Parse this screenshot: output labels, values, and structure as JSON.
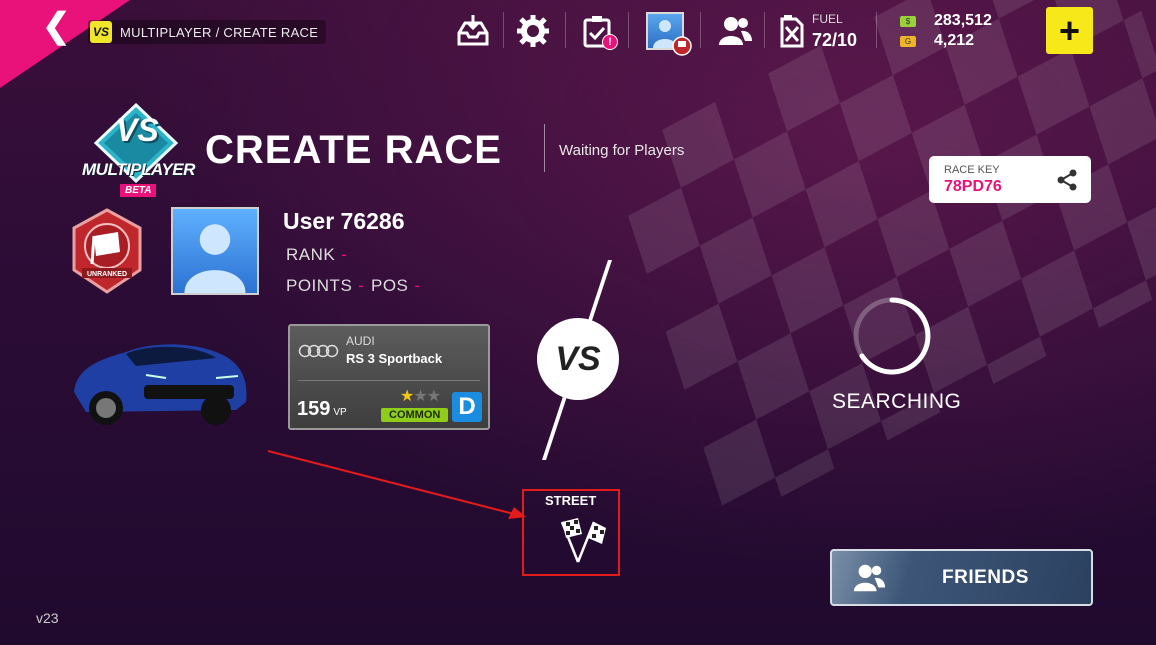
{
  "breadcrumb": {
    "logo": "VS",
    "text": "MULTIPLAYER / CREATE RACE"
  },
  "topbar": {
    "icons": [
      "inbox-icon",
      "gear-icon",
      "task-clipboard-icon",
      "profile-avatar-icon",
      "friends-icon",
      "fuel-can-icon"
    ],
    "task_badge": "!",
    "fuel_label": "FUEL",
    "fuel_value": "72/10",
    "credits": "283,512",
    "credits_chip": "$",
    "tokens": "4,212",
    "tokens_chip": "G",
    "plus_label": "+"
  },
  "header": {
    "logo_text": "VS",
    "multiplayer": "MULTIPLAYER",
    "beta": "BETA",
    "title": "CREATE RACE",
    "subtitle": "Waiting for Players"
  },
  "race_key": {
    "label": "RACE KEY",
    "value": "78PD76"
  },
  "player": {
    "rank_badge": "UNRANKED",
    "name": "User 76286",
    "rank_label": "RANK",
    "rank_value": "-",
    "points_label": "POINTS",
    "points_value": "-",
    "pos_label": "POS",
    "pos_value": "-"
  },
  "car": {
    "brand": "AUDI",
    "model": "RS 3 Sportback",
    "vp": "159",
    "vp_unit": "VP",
    "stars": 1,
    "stars_max": 3,
    "rarity": "COMMON",
    "class": "D"
  },
  "versus": "VS",
  "opponent": {
    "status": "SEARCHING"
  },
  "race_type": {
    "label": "STREET"
  },
  "friends_button": {
    "label": "FRIENDS"
  },
  "version": "v23",
  "colors": {
    "accent": "#e8127a",
    "yellow": "#f7e81a",
    "highlight_red": "#e31b1b",
    "common_green": "#8fcd1a",
    "class_blue": "#1b8de0"
  }
}
